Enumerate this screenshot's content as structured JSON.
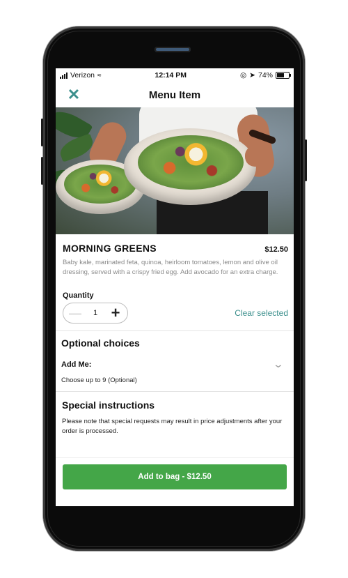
{
  "status_bar": {
    "carrier": "Verizon",
    "time": "12:14 PM",
    "battery": "74%",
    "battery_level": 0.74
  },
  "nav": {
    "title": "Menu Item",
    "close_icon": "close-icon"
  },
  "item": {
    "name": "MORNING GREENS",
    "price": "$12.50",
    "description": "Baby kale, marinated feta, quinoa, heirloom tomatoes, lemon and olive oil dressing, served with a crispy fried egg. Add avocado for an extra charge."
  },
  "quantity": {
    "label": "Quantity",
    "value": "1",
    "clear_label": "Clear selected"
  },
  "optional": {
    "title": "Optional choices",
    "group_title": "Add Me:",
    "group_subtitle": "Choose up to 9 (Optional)"
  },
  "special": {
    "title": "Special instructions",
    "note": "Please note that special requests may result in price adjustments after your order is processed."
  },
  "cta": {
    "label": "Add to bag - $12.50"
  },
  "colors": {
    "accent": "#3b8f8c",
    "cta": "#44a648"
  }
}
